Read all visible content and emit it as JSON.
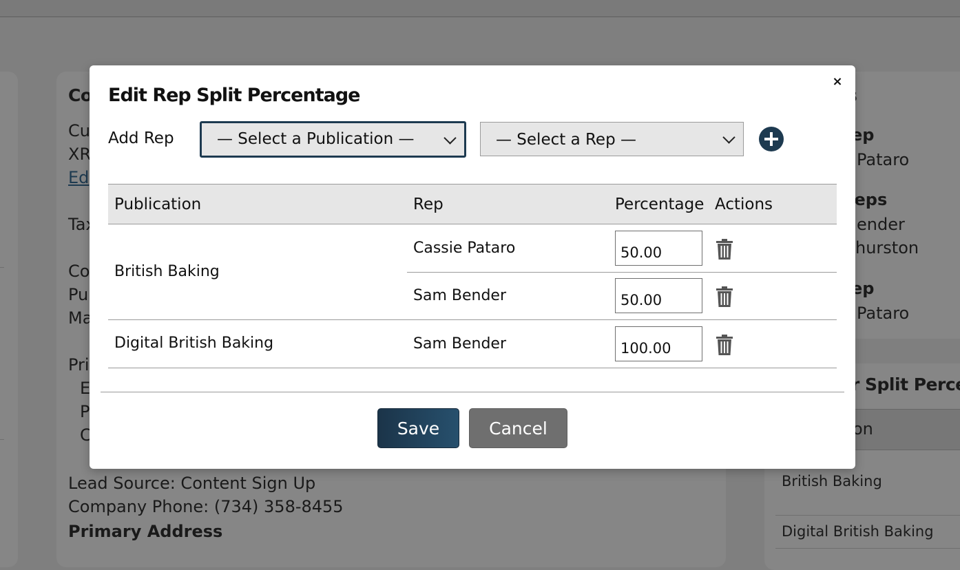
{
  "background": {
    "main_lines": [
      "Co",
      "Cu",
      "XR",
      "Ed",
      "Tax",
      "Co",
      "Pu",
      "Ma",
      "Pri",
      "E",
      "P",
      "C"
    ],
    "lead_source": "Lead Source: Content Sign Up",
    "company_phone": "Company Phone: (734) 358-8455",
    "primary_address": "Primary Address",
    "right_lines": [
      "s",
      "ep",
      "Pataro",
      "Reps",
      "ender",
      "hurston",
      "ep",
      "Pataro"
    ],
    "split_heading": "r Split Percenta",
    "split_col": "on",
    "split_rows": [
      "British Baking",
      "Digital British Baking"
    ]
  },
  "modal": {
    "title": "Edit Rep Split Percentage",
    "close_label": "×",
    "add_rep_label": "Add Rep",
    "publication_select": "— Select a Publication —",
    "rep_select": "— Select a Rep —",
    "table": {
      "headers": [
        "Publication",
        "Rep",
        "Percentage",
        "Actions"
      ],
      "groups": [
        {
          "publication": "British Baking",
          "reps": [
            {
              "rep": "Cassie Pataro",
              "percentage": "50.00"
            },
            {
              "rep": "Sam Bender",
              "percentage": "50.00"
            }
          ]
        },
        {
          "publication": "Digital British Baking",
          "reps": [
            {
              "rep": "Sam Bender",
              "percentage": "100.00"
            }
          ]
        }
      ]
    },
    "save_label": "Save",
    "cancel_label": "Cancel"
  },
  "colors": {
    "accent": "#1d3a50",
    "cancel": "#6f6f6f",
    "overlay": "#7f7f7f"
  }
}
